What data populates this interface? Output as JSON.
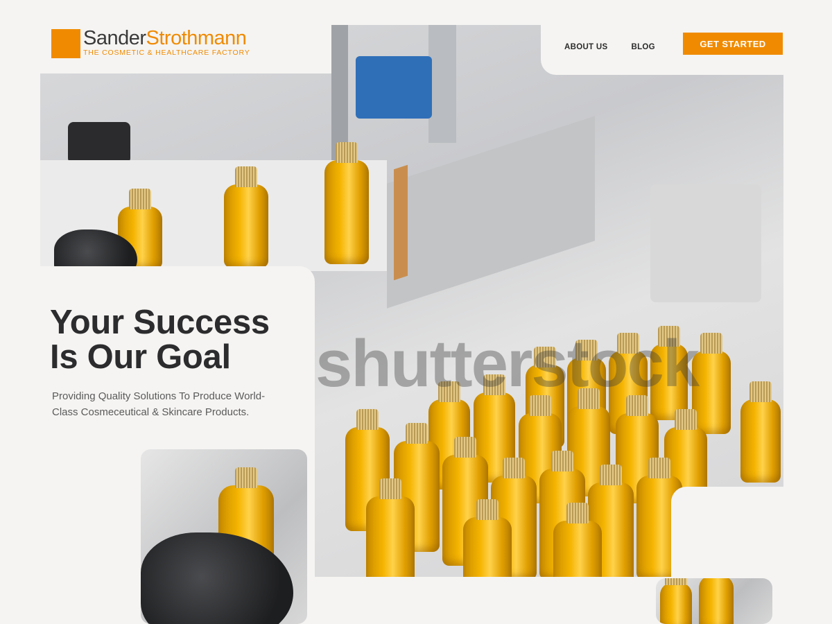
{
  "brand": {
    "name_part1": "Sander",
    "name_part2": "Strothmann",
    "tagline": "THE COSMETIC & HEALTHCARE FACTORY",
    "accent_color": "#f08a00"
  },
  "nav": {
    "items": [
      {
        "label": "ABOUT US"
      },
      {
        "label": "BLOG"
      }
    ],
    "cta_label": "GET STARTED"
  },
  "hero": {
    "title_line1": "Your Success",
    "title_line2": "Is Our Goal",
    "subtitle": "Providing Quality Solutions To Produce World-Class  Cosmeceutical & Skincare Products."
  },
  "watermark": "shutterstock",
  "images": {
    "main": "factory-bottling-line",
    "thumb_left": "gloved-hand-holding-bottle",
    "thumb_right": "amber-bottles"
  }
}
